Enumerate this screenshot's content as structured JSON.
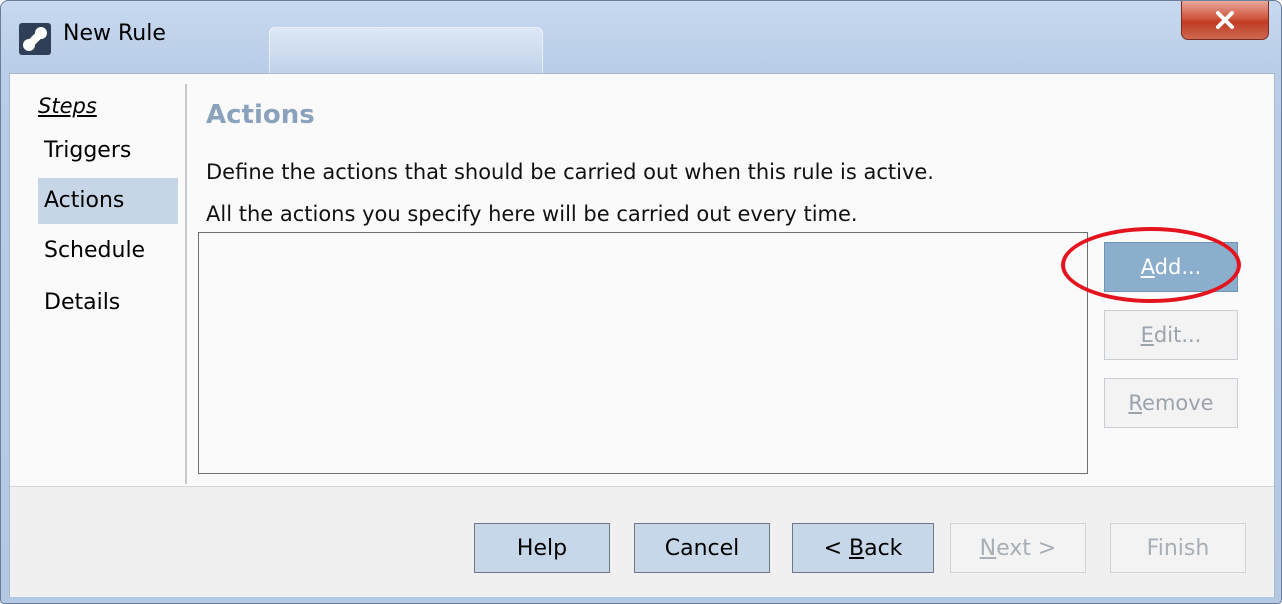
{
  "window": {
    "title": "New Rule",
    "icon": "app-icon",
    "close_label": "X"
  },
  "steps": {
    "header": "Steps",
    "items": [
      {
        "label": "Triggers",
        "active": false
      },
      {
        "label": "Actions",
        "active": true
      },
      {
        "label": "Schedule",
        "active": false
      },
      {
        "label": "Details",
        "active": false
      }
    ]
  },
  "main": {
    "section_title": "Actions",
    "description_line1": "Define the actions that should be carried out when this rule is active.",
    "description_line2": "All the actions you specify here will be carried out every time.",
    "actions_list": [],
    "buttons": {
      "add": {
        "label": "Add...",
        "access_key": "A",
        "rest": "dd...",
        "enabled": true
      },
      "edit": {
        "label": "Edit...",
        "access_key": "E",
        "rest": "dit...",
        "enabled": false
      },
      "remove": {
        "label": "Remove",
        "access_key": "R",
        "rest": "emove",
        "enabled": false
      }
    }
  },
  "footer": {
    "help": {
      "label": "Help",
      "enabled": true
    },
    "cancel": {
      "label": "Cancel",
      "enabled": true
    },
    "back": {
      "label": "< Back",
      "prefix": "< ",
      "access_key": "B",
      "rest": "ack",
      "enabled": true
    },
    "next": {
      "label": "Next >",
      "access_key": "N",
      "rest": "ext >",
      "enabled": false
    },
    "finish": {
      "label": "Finish",
      "enabled": false
    }
  },
  "annotation": {
    "color": "#e4141e",
    "target": "add-button"
  },
  "colors": {
    "accent": "#8caecd",
    "title_bar": "#b9cde7",
    "close_red": "#c03b24"
  }
}
